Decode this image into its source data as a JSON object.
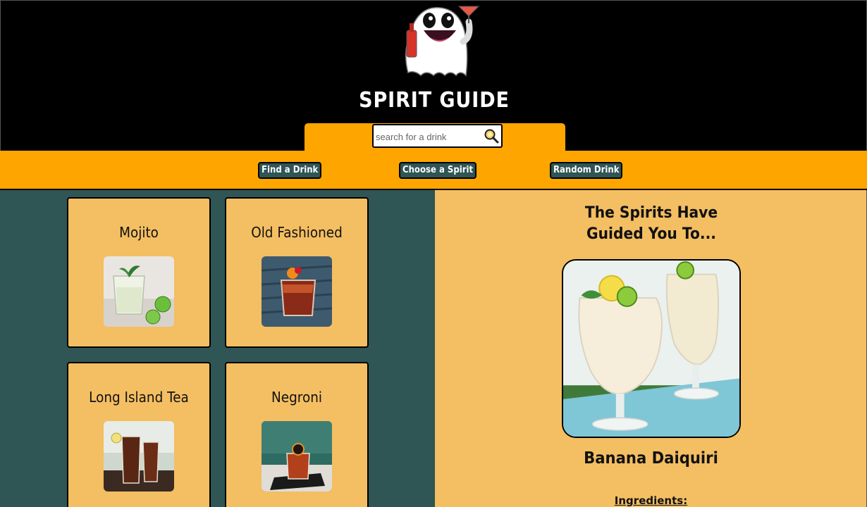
{
  "header": {
    "brand": "SPIRIT GUIDE",
    "logo_icon": "ghost-holding-cocktail-icon",
    "search": {
      "placeholder": "search for a drink",
      "value": "",
      "icon": "magnifier-icon"
    }
  },
  "nav": {
    "items": [
      {
        "label": "Find a Drink"
      },
      {
        "label": "Choose a Spirit"
      },
      {
        "label": "Random Drink"
      }
    ]
  },
  "drinks": [
    {
      "name": "Mojito"
    },
    {
      "name": "Old Fashioned"
    },
    {
      "name": "Long Island Tea"
    },
    {
      "name": "Negroni"
    }
  ],
  "featured": {
    "heading": "The Spirits Have Guided You To...",
    "drink_name": "Banana Daiquiri",
    "ingredients_label": "Ingredients:"
  },
  "colors": {
    "orange": "#ffa500",
    "card": "#f4be62",
    "teal": "#2f5554",
    "black": "#000000"
  }
}
